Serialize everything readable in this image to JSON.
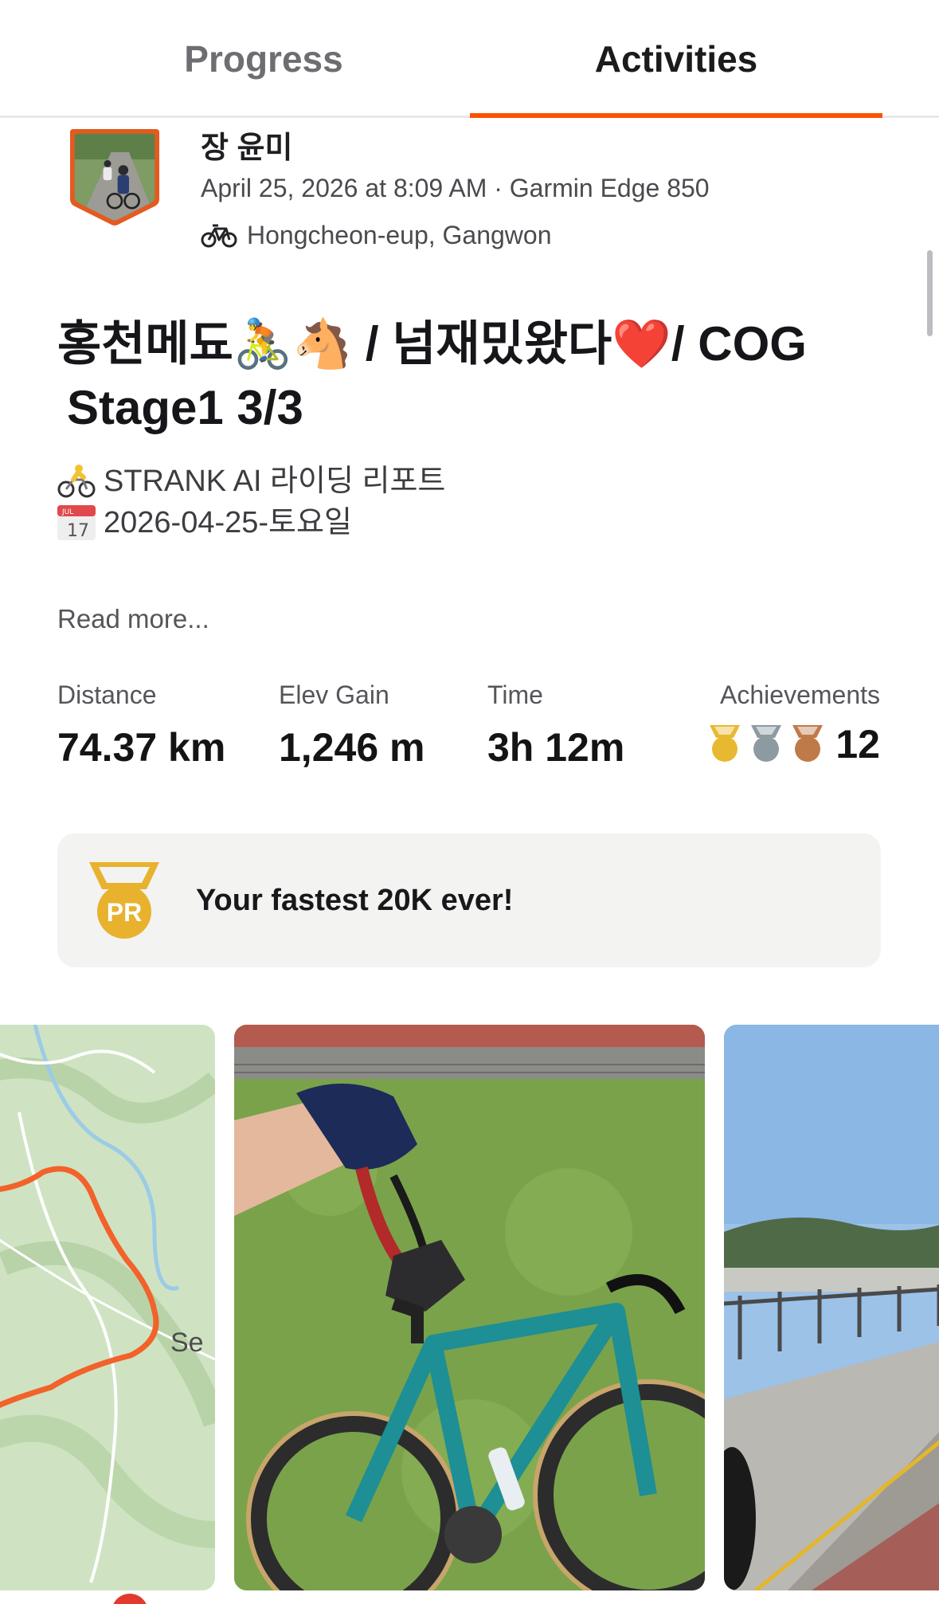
{
  "tabs": [
    {
      "label": "Progress",
      "active": false
    },
    {
      "label": "Activities",
      "active": true
    }
  ],
  "accent_color": "#fc5200",
  "activity": {
    "athlete_name": "장 윤미",
    "meta": "April 25, 2026 at 8:09 AM · Garmin Edge 850",
    "sport_icon": "bike-icon",
    "location": "Hongcheon-eup, Gangwon",
    "title_line1": "홍천메됴🚴🐴 / 넘재밌왔다❤️/ COG",
    "title_line2": "Stage1 3/3",
    "description_line1": "STRANK AI 라이딩 리포트",
    "description_line2": "2026-04-25-토요일",
    "calendar_month": "JUL",
    "calendar_day": "17",
    "read_more": "Read more...",
    "stats": {
      "distance": {
        "label": "Distance",
        "value": "74.37 km"
      },
      "elev_gain": {
        "label": "Elev Gain",
        "value": "1,246 m"
      },
      "time": {
        "label": "Time",
        "value": "3h 12m"
      },
      "achievements": {
        "label": "Achievements",
        "value": "12",
        "medals": [
          "gold",
          "silver",
          "bronze"
        ]
      }
    },
    "pr": {
      "badge": "PR",
      "text": "Your fastest 20K ever!"
    },
    "map_label": "Se"
  }
}
